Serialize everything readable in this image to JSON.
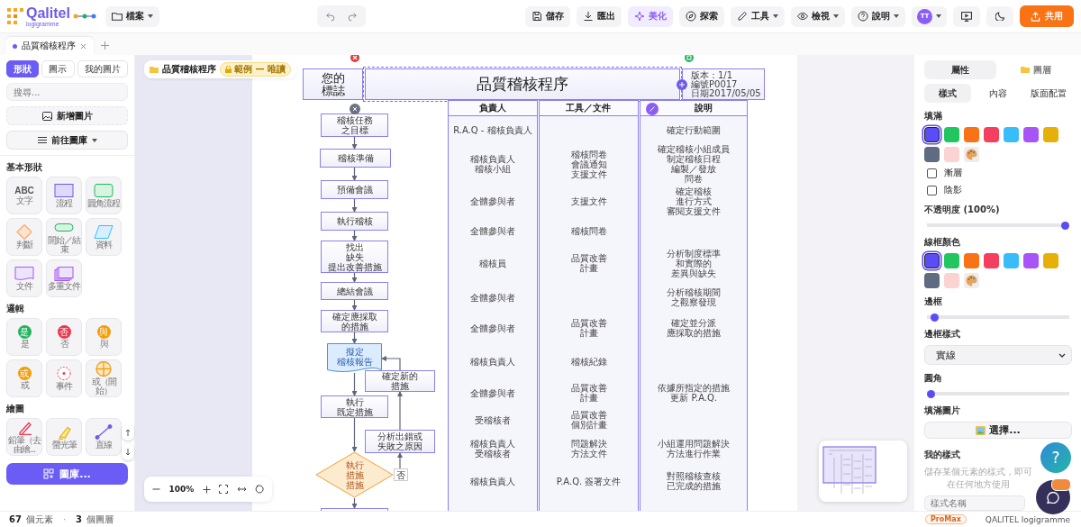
{
  "app": {
    "name": "Qalitel",
    "tagline": "logigramme"
  },
  "file_menu": {
    "label": "檔案"
  },
  "toolbar": [
    {
      "label": "儲存",
      "kind": "save",
      "accent": false,
      "menu": false
    },
    {
      "label": "匯出",
      "kind": "export",
      "accent": false,
      "menu": false
    },
    {
      "label": "美化",
      "kind": "beautify",
      "accent": true,
      "menu": false
    },
    {
      "label": "探索",
      "kind": "explore",
      "accent": false,
      "menu": false
    },
    {
      "label": "工具",
      "kind": "tools",
      "accent": false,
      "menu": true
    },
    {
      "label": "檢視",
      "kind": "view",
      "accent": false,
      "menu": true
    },
    {
      "label": "說明",
      "kind": "help",
      "accent": false,
      "menu": true
    }
  ],
  "user": {
    "initials": "TT"
  },
  "share_button": {
    "label": "共用"
  },
  "doc_tabs": [
    {
      "label": "品質稽核程序",
      "selected": true
    }
  ],
  "left_panel": {
    "tabs": [
      {
        "label": "形狀",
        "selected": true
      },
      {
        "label": "圖示",
        "selected": false
      },
      {
        "label": "我的圖片",
        "selected": false
      }
    ],
    "search": {
      "placeholder": "搜尋..."
    },
    "add_image": "新增圖片",
    "library": "前往圖庫",
    "sections": [
      {
        "title": "基本形狀",
        "items": [
          {
            "kind": "text",
            "glyph": "ABC",
            "label": "文字"
          },
          {
            "kind": "process",
            "label": "流程"
          },
          {
            "kind": "rounded",
            "label": "圓角流程"
          },
          {
            "kind": "decision",
            "label": "判斷"
          },
          {
            "kind": "terminal",
            "label": "開始／結束"
          },
          {
            "kind": "data",
            "label": "資料"
          },
          {
            "kind": "document",
            "label": "文件"
          },
          {
            "kind": "multidoc",
            "label": "多重文件"
          }
        ]
      },
      {
        "title": "邏輯",
        "items": [
          {
            "kind": "badge",
            "glyph": "是",
            "color": "#22b35e",
            "label": "是"
          },
          {
            "kind": "badge",
            "glyph": "否",
            "color": "#e8384f",
            "label": "否"
          },
          {
            "kind": "badge",
            "glyph": "與",
            "color": "#f29d0c",
            "label": "與"
          },
          {
            "kind": "badge",
            "glyph": "或",
            "color": "#f29d0c",
            "label": "或"
          },
          {
            "kind": "event",
            "label": "事件"
          },
          {
            "kind": "or-start",
            "label": "或（開始）"
          }
        ]
      },
      {
        "title": "繪圖",
        "items": [
          {
            "kind": "pencil",
            "label": "鉛筆（去由繪..."
          },
          {
            "kind": "highlighter",
            "label": "螢光筆"
          },
          {
            "kind": "line",
            "label": "直線"
          }
        ]
      }
    ],
    "gallery_button": "圖庫..."
  },
  "breadcrumb": {
    "title": "品質稽核程序",
    "badge": "範例 — 唯讀"
  },
  "diagram": {
    "logo": [
      "您的",
      "標誌"
    ],
    "title": "品質稽核程序",
    "info": [
      "版本：1/1",
      "編號P0017",
      "日期2017/05/05"
    ],
    "columns": [
      "負責人",
      "工具／文件",
      "說明"
    ],
    "rows": [
      {
        "owner": [
          "R.A.Q - 稽核負責人"
        ],
        "notes": [
          "確定行動範圍"
        ]
      },
      {
        "owner": [
          "稽核負責人",
          "稽核小組"
        ],
        "tools": [
          "稽核問卷",
          "會議通知",
          "支援文件"
        ],
        "notes": [
          "確定稽核小組成員",
          "制定稽核日程",
          "編製／發放",
          "問卷"
        ]
      },
      {
        "owner": [
          "全體參與者"
        ],
        "tools": [
          "支援文件"
        ],
        "notes": [
          "確定稽核",
          "進行方式",
          "審閱支援文件"
        ]
      },
      {
        "owner": [
          "全體參與者"
        ],
        "tools": [
          "稽核問卷"
        ]
      },
      {
        "owner": [
          "稽核員"
        ],
        "tools": [
          "品質改善",
          "計畫"
        ],
        "notes": [
          "分析制度標準",
          "和實際的",
          "差異與缺失"
        ]
      },
      {
        "owner": [
          "全體參與者"
        ],
        "notes": [
          "分析稽核期間",
          "之觀察發現"
        ]
      },
      {
        "owner": [
          "全體參與者"
        ],
        "tools": [
          "品質改善",
          "計畫"
        ],
        "notes": [
          "確定並分派",
          "應採取的措施"
        ]
      },
      {
        "owner": [
          "稽核負責人"
        ],
        "tools": [
          "稽核紀錄"
        ]
      },
      {
        "owner": [
          "全體參與者"
        ],
        "tools": [
          "品質改善",
          "計畫"
        ],
        "notes": [
          "依據所指定的措施",
          "更新 P.A.Q."
        ]
      },
      {
        "owner": [
          "受稽核者"
        ],
        "tools": [
          "品質改善",
          "個別計畫"
        ]
      },
      {
        "owner": [
          "稽核負責人",
          "受稽核者"
        ],
        "tools": [
          "問題解決",
          "方法文件"
        ],
        "notes": [
          "小組運用問題解決",
          "方法進行作業"
        ]
      },
      {
        "owner": [
          "稽核負責人"
        ],
        "tools": [
          "P.A.Q. 簽署文件"
        ],
        "notes": [
          "對照稽核查核",
          "已完成的措施"
        ]
      }
    ],
    "nodes": [
      {
        "kind": "process",
        "text": [
          "稽核任務",
          "之目標"
        ]
      },
      {
        "kind": "process",
        "text": [
          "稽核準備"
        ]
      },
      {
        "kind": "process",
        "text": [
          "預備會議"
        ]
      },
      {
        "kind": "process",
        "text": [
          "執行稽核"
        ]
      },
      {
        "kind": "process",
        "text": [
          "找出",
          "缺失",
          "提出改善措施"
        ]
      },
      {
        "kind": "process",
        "text": [
          "總結會議"
        ]
      },
      {
        "kind": "process",
        "text": [
          "確定應採取",
          "的措施"
        ]
      },
      {
        "kind": "document",
        "text": [
          "擬定",
          "稽核報告"
        ]
      },
      {
        "kind": "process",
        "text": [
          "確定新的",
          "措施"
        ]
      },
      {
        "kind": "process",
        "text": [
          "執行",
          "既定措施"
        ]
      },
      {
        "kind": "process",
        "text": [
          "分析出錯或",
          "失敗之原因"
        ]
      },
      {
        "kind": "decision",
        "text": [
          "執行",
          "措施",
          "措施"
        ]
      },
      {
        "kind": "label",
        "text": [
          "否"
        ]
      },
      {
        "kind": "process"
      }
    ]
  },
  "zoom": {
    "value": "100%"
  },
  "right_panel": {
    "tabs": [
      {
        "label": "屬性",
        "selected": true
      },
      {
        "label": "圖層",
        "selected": false
      }
    ],
    "subtabs": [
      {
        "label": "樣式",
        "selected": true
      },
      {
        "label": "內容",
        "selected": false
      },
      {
        "label": "版面配置",
        "selected": false
      }
    ],
    "fill": {
      "label": "填滿",
      "swatches": [
        {
          "color": "#5b4df5",
          "selected": true
        },
        {
          "color": "#22c55e",
          "selected": false
        },
        {
          "color": "#f97316",
          "selected": false
        },
        {
          "color": "#f43f5e",
          "selected": false
        },
        {
          "color": "#38bdf8",
          "selected": false
        },
        {
          "color": "#a855f7",
          "selected": false
        },
        {
          "color": "#e5b00a",
          "selected": false
        },
        {
          "color": "#5f6b80",
          "selected": false
        },
        {
          "color": "#fbd3d3",
          "selected": false
        }
      ]
    },
    "options": [
      {
        "label": "漸層",
        "checked": false
      },
      {
        "label": "陰影",
        "checked": false
      }
    ],
    "opacity": {
      "label": "不透明度 (100%)",
      "level": 1
    },
    "stroke": {
      "label": "線框顏色",
      "swatches": [
        {
          "color": "#5b4df5",
          "selected": true
        },
        {
          "color": "#22c55e",
          "selected": false
        },
        {
          "color": "#f97316",
          "selected": false
        },
        {
          "color": "#f43f5e",
          "selected": false
        },
        {
          "color": "#38bdf8",
          "selected": false
        },
        {
          "color": "#a855f7",
          "selected": false
        },
        {
          "color": "#e5b00a",
          "selected": false
        },
        {
          "color": "#5f6b80",
          "selected": false
        },
        {
          "color": "#fbd3d3",
          "selected": false
        }
      ]
    },
    "border": {
      "label": "邊框",
      "level": 0.03
    },
    "border_style": {
      "label": "邊框樣式",
      "value": "實線"
    },
    "radius": {
      "label": "圓角",
      "level": 0
    },
    "fill_image": {
      "label": "填滿圖片",
      "button": "選擇..."
    },
    "my_styles": {
      "title": "我的樣式",
      "hint": "儲存某個元素的樣式，即可在任何地方使用",
      "placeholder": "樣式名稱"
    }
  },
  "help_fab": {
    "glyph": "?"
  },
  "status_bar": {
    "elements_count": "67",
    "elements_label": "個元素",
    "separator": "·",
    "layers_count": "3",
    "layers_label": "個圖層",
    "plan": "ProMax",
    "product": "QALITEL logigramme"
  }
}
